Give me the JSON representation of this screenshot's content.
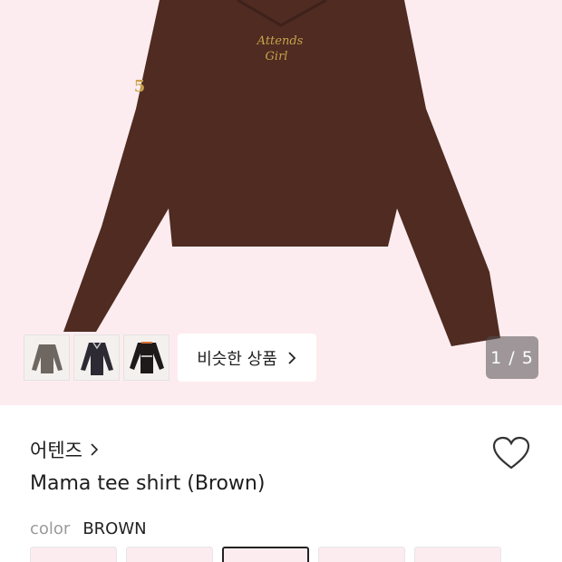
{
  "hero": {
    "image_alt": "brown long sleeve tee",
    "chest_print_line1": "Attends",
    "chest_print_line2": "Girl",
    "sleeve_print": "5",
    "background_color": "#fdecef",
    "shirt_color": "#4f2b22",
    "print_color": "#c9a24a"
  },
  "thumbnails": [
    {
      "name": "thumb-gray-tee",
      "color": "#6e6660"
    },
    {
      "name": "thumb-navy-tee",
      "color": "#2e2a33"
    },
    {
      "name": "thumb-black-tee",
      "color": "#1e1a1a"
    }
  ],
  "similar_button": {
    "label": "비슷한 상품"
  },
  "pager": {
    "text": "1 / 5"
  },
  "product": {
    "brand": "어텐즈",
    "title": "Mama tee shirt (Brown)",
    "color_label": "color",
    "color_value": "BROWN"
  }
}
